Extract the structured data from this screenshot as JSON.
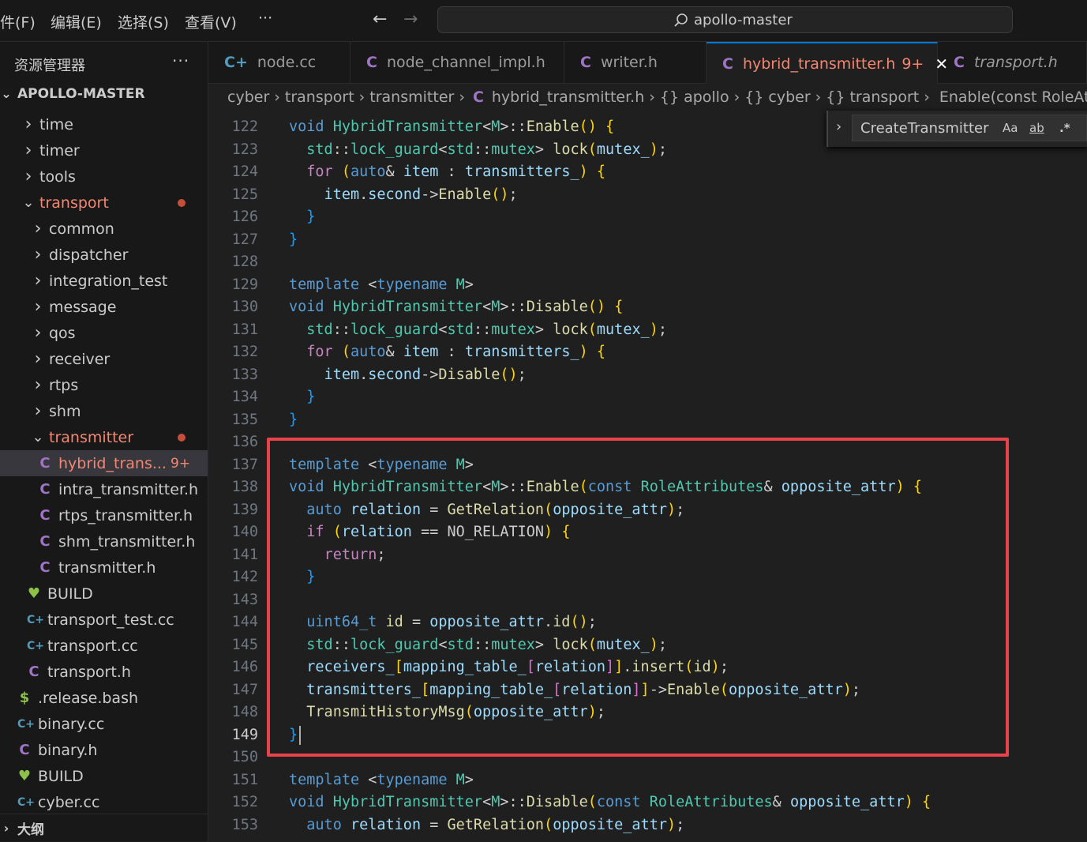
{
  "menu": {
    "items": [
      "件(F)",
      "编辑(E)",
      "选择(S)",
      "查看(V)"
    ],
    "more": "···"
  },
  "nav": {
    "back": "←",
    "forward": "→"
  },
  "command_center": {
    "text": "apollo-master"
  },
  "sidebar": {
    "title": "资源管理器",
    "more": "···",
    "root": "APOLLO-MASTER",
    "items": [
      {
        "label": "time"
      },
      {
        "label": "timer"
      },
      {
        "label": "tools"
      },
      {
        "label": "transport"
      },
      {
        "label": "common"
      },
      {
        "label": "dispatcher"
      },
      {
        "label": "integration_test"
      },
      {
        "label": "message"
      },
      {
        "label": "qos"
      },
      {
        "label": "receiver"
      },
      {
        "label": "rtps"
      },
      {
        "label": "shm"
      },
      {
        "label": "transmitter"
      },
      {
        "label": "hybrid_trans...",
        "badge": "9+"
      },
      {
        "label": "intra_transmitter.h"
      },
      {
        "label": "rtps_transmitter.h"
      },
      {
        "label": "shm_transmitter.h"
      },
      {
        "label": "transmitter.h"
      },
      {
        "label": "BUILD"
      },
      {
        "label": "transport_test.cc"
      },
      {
        "label": "transport.cc"
      },
      {
        "label": "transport.h"
      },
      {
        "label": ".release.bash"
      },
      {
        "label": "binary.cc"
      },
      {
        "label": "binary.h"
      },
      {
        "label": "BUILD"
      },
      {
        "label": "cyber.cc"
      }
    ],
    "outline": "大纲"
  },
  "tabs": [
    {
      "label": "node.cc",
      "icon": "cpp-file-icon"
    },
    {
      "label": "node_channel_impl.h",
      "icon": "c-header-icon"
    },
    {
      "label": "writer.h",
      "icon": "c-header-icon"
    },
    {
      "label": "hybrid_transmitter.h",
      "badge": "9+",
      "icon": "c-header-icon"
    },
    {
      "label": "transport.h",
      "icon": "c-header-icon"
    }
  ],
  "breadcrumb": {
    "parts": [
      "cyber",
      "transport",
      "transmitter",
      "hybrid_transmitter.h",
      "apollo",
      "cyber",
      "transport",
      "Enable(const RoleAttrib"
    ],
    "namespace_glyph": "{}"
  },
  "find_widget": {
    "value": "CreateTransmitter",
    "opt_case": "Aa",
    "opt_word": "ab",
    "opt_regex": ".*"
  },
  "editor": {
    "current_line": "149",
    "lines": [
      {
        "n": "122",
        "t": "void HybridTransmitter<M>::Enable() {"
      },
      {
        "n": "123",
        "t": "  std::lock_guard<std::mutex> lock(mutex_);"
      },
      {
        "n": "124",
        "t": "  for (auto& item : transmitters_) {"
      },
      {
        "n": "125",
        "t": "    item.second->Enable();"
      },
      {
        "n": "126",
        "t": "  }"
      },
      {
        "n": "127",
        "t": "}"
      },
      {
        "n": "128",
        "t": ""
      },
      {
        "n": "129",
        "t": "template <typename M>"
      },
      {
        "n": "130",
        "t": "void HybridTransmitter<M>::Disable() {"
      },
      {
        "n": "131",
        "t": "  std::lock_guard<std::mutex> lock(mutex_);"
      },
      {
        "n": "132",
        "t": "  for (auto& item : transmitters_) {"
      },
      {
        "n": "133",
        "t": "    item.second->Disable();"
      },
      {
        "n": "134",
        "t": "  }"
      },
      {
        "n": "135",
        "t": "}"
      },
      {
        "n": "136",
        "t": ""
      },
      {
        "n": "137",
        "t": "template <typename M>"
      },
      {
        "n": "138",
        "t": "void HybridTransmitter<M>::Enable(const RoleAttributes& opposite_attr) {"
      },
      {
        "n": "139",
        "t": "  auto relation = GetRelation(opposite_attr);"
      },
      {
        "n": "140",
        "t": "  if (relation == NO_RELATION) {"
      },
      {
        "n": "141",
        "t": "    return;"
      },
      {
        "n": "142",
        "t": "  }"
      },
      {
        "n": "143",
        "t": ""
      },
      {
        "n": "144",
        "t": "  uint64_t id = opposite_attr.id();"
      },
      {
        "n": "145",
        "t": "  std::lock_guard<std::mutex> lock(mutex_);"
      },
      {
        "n": "146",
        "t": "  receivers_[mapping_table_[relation]].insert(id);"
      },
      {
        "n": "147",
        "t": "  transmitters_[mapping_table_[relation]]->Enable(opposite_attr);"
      },
      {
        "n": "148",
        "t": "  TransmitHistoryMsg(opposite_attr);"
      },
      {
        "n": "149",
        "t": "}"
      },
      {
        "n": "150",
        "t": ""
      },
      {
        "n": "151",
        "t": "template <typename M>"
      },
      {
        "n": "152",
        "t": "void HybridTransmitter<M>::Disable(const RoleAttributes& opposite_attr) {"
      },
      {
        "n": "153",
        "t": "  auto relation = GetRelation(opposite_attr);"
      }
    ]
  },
  "colors": {
    "accent": "#0078d4",
    "highlight_box": "#e8424a",
    "git_modified": "#f48771"
  }
}
